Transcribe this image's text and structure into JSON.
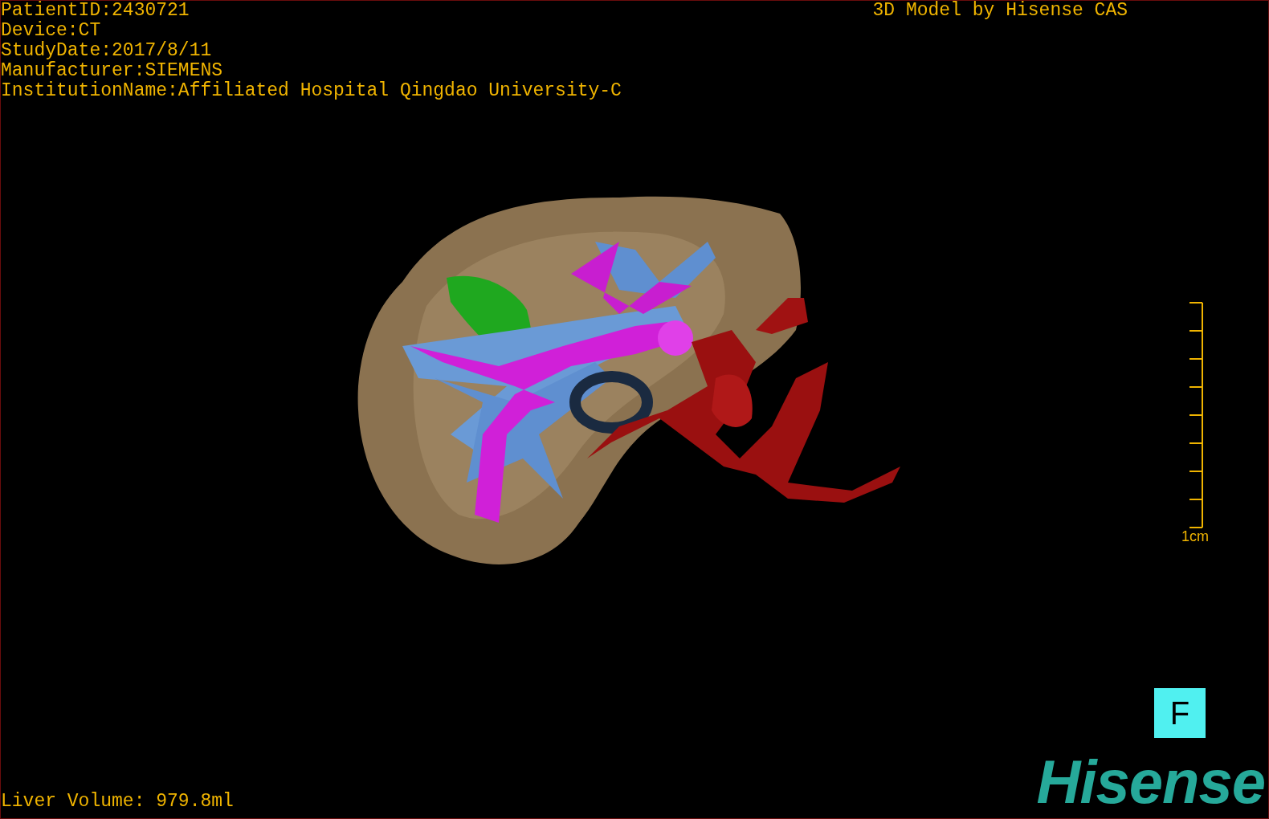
{
  "patient_info": [
    {
      "kind": "field",
      "text": "PatientID:2430721"
    },
    {
      "kind": "field",
      "text": "Device:CT"
    },
    {
      "kind": "field",
      "text": "StudyDate:2017/8/11"
    },
    {
      "kind": "field",
      "text": "Manufacturer:SIEMENS"
    },
    {
      "kind": "field",
      "text": "InstitutionName:Affiliated Hospital Qingdao University-C"
    }
  ],
  "model_title": "3D Model by Hisense CAS",
  "scale_bar": {
    "label": "1cm"
  },
  "orientation_marker": "F",
  "liver_volume": "Liver Volume: 979.8ml",
  "logo": "Hisense"
}
